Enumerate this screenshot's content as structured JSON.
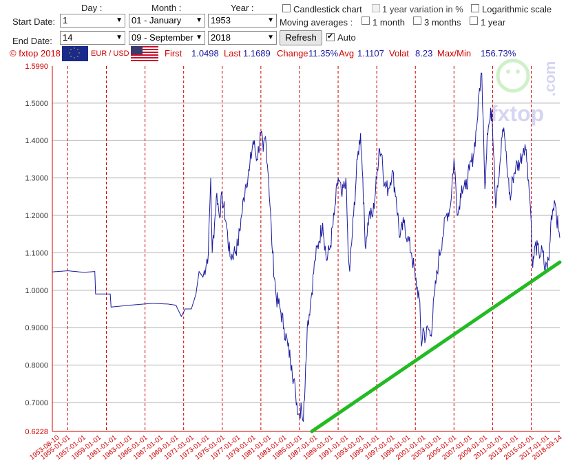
{
  "form": {
    "day_label": "Day :",
    "month_label": "Month :",
    "year_label": "Year :",
    "start_label": "Start Date:",
    "end_label": "End Date:",
    "start_day": "1",
    "start_month": "01 - January",
    "start_year": "1953",
    "end_day": "14",
    "end_month": "09 - September",
    "end_year": "2018",
    "refresh_label": "Refresh",
    "moving_label": "Moving averages :",
    "candlestick_label": "Candlestick chart",
    "variation_label": "1 year variation in %",
    "log_label": "Logarithmic scale",
    "ma_1m_label": "1 month",
    "ma_3m_label": "3 months",
    "ma_1y_label": "1 year",
    "auto_label": "Auto",
    "auto_checked": true
  },
  "info": {
    "copyright": "© fxtop 2018",
    "pair": "EUR / USD",
    "first_label": "First",
    "first_value": "1.0498",
    "last_label": "Last",
    "last_value": "1.1689",
    "change_label": "Change",
    "change_value": "11.35%",
    "avg_label": "Avg",
    "avg_value": "1.1107",
    "volat_label": "Volat",
    "volat_value": "8.23",
    "maxmin_label": "Max/Min",
    "maxmin_value": "156.73%"
  },
  "watermark": "fxtop",
  "watermark_suffix": ".com",
  "colors": {
    "price_line": "#1a1aa0",
    "trend_line": "#22bb22",
    "axis_red": "#d00000",
    "grid_h": "#b0b0b0"
  },
  "chart_data": {
    "type": "line",
    "yticks": [
      "0.6228",
      "0.7000",
      "0.8000",
      "0.9000",
      "1.0000",
      "1.1000",
      "1.2000",
      "1.3000",
      "1.4000",
      "1.5000",
      "1.5990"
    ],
    "ylim": [
      0.6228,
      1.599
    ],
    "xlim": [
      1953.0,
      2018.7
    ],
    "xticks": [
      "1953-08-10",
      "1955-01-01",
      "1957-01-01",
      "1959-01-01",
      "1961-01-01",
      "1963-01-01",
      "1965-01-01",
      "1967-01-01",
      "1969-01-01",
      "1971-01-01",
      "1973-01-01",
      "1975-01-01",
      "1977-01-01",
      "1979-01-01",
      "1981-01-01",
      "1983-01-01",
      "1985-01-01",
      "1987-01-01",
      "1989-01-01",
      "1991-01-01",
      "1993-01-01",
      "1995-01-01",
      "1997-01-01",
      "1999-01-01",
      "2001-01-01",
      "2003-01-01",
      "2005-01-01",
      "2007-01-01",
      "2009-01-01",
      "2011-01-01",
      "2013-01-01",
      "2015-01-01",
      "2017-01-01",
      "2018-09-14"
    ],
    "grid_years": [
      1955,
      1960,
      1965,
      1970,
      1975,
      1980,
      1985,
      1990,
      1995,
      2000,
      2005,
      2010,
      2015
    ],
    "series": [
      {
        "x": [
          1953.0,
          1955.0,
          1957.0,
          1957.2,
          1958.5,
          1958.6,
          1960.5,
          1960.6,
          1963.0,
          1966.0,
          1968.0,
          1969.0,
          1969.7,
          1970.2,
          1971.0,
          1971.6,
          1972.0,
          1972.5,
          1973.2,
          1973.5,
          1973.7,
          1974.0,
          1974.3,
          1974.6,
          1975.0,
          1975.5,
          1976.0,
          1976.5,
          1977.0,
          1977.5,
          1978.0,
          1978.5,
          1979.0,
          1979.5,
          1980.0,
          1980.3,
          1980.6,
          1981.0,
          1981.5,
          1982.0,
          1982.5,
          1983.0,
          1983.5,
          1984.0,
          1984.5,
          1985.0,
          1985.2,
          1985.5,
          1985.8,
          1986.0,
          1986.5,
          1987.0,
          1987.5,
          1988.0,
          1988.5,
          1989.0,
          1989.5,
          1990.0,
          1990.5,
          1991.0,
          1991.3,
          1991.5,
          1992.0,
          1992.5,
          1992.9,
          1993.2,
          1993.5,
          1994.0,
          1994.5,
          1995.0,
          1995.3,
          1995.7,
          1996.0,
          1996.5,
          1997.0,
          1997.5,
          1998.0,
          1998.5,
          1999.0,
          1999.5,
          2000.0,
          2000.5,
          2000.8,
          2001.0,
          2001.3,
          2001.6,
          2002.0,
          2002.5,
          2003.0,
          2003.5,
          2004.0,
          2004.5,
          2005.0,
          2005.5,
          2006.0,
          2006.5,
          2007.0,
          2007.5,
          2008.0,
          2008.3,
          2008.6,
          2008.8,
          2009.0,
          2009.3,
          2009.6,
          2009.9,
          2010.2,
          2010.4,
          2010.6,
          2011.0,
          2011.3,
          2011.6,
          2012.0,
          2012.3,
          2012.6,
          2013.0,
          2013.5,
          2014.0,
          2014.2,
          2014.5,
          2014.8,
          2015.0,
          2015.2,
          2015.5,
          2016.0,
          2016.5,
          2016.8,
          2017.0,
          2017.3,
          2017.6,
          2018.0,
          2018.2,
          2018.5,
          2018.7
        ],
        "y": [
          1.049,
          1.052,
          1.048,
          1.048,
          1.05,
          0.99,
          0.99,
          0.955,
          0.96,
          0.965,
          0.963,
          0.96,
          0.93,
          0.95,
          0.95,
          0.99,
          1.05,
          1.035,
          1.1,
          1.3,
          1.1,
          1.18,
          1.26,
          1.2,
          1.25,
          1.18,
          1.09,
          1.1,
          1.12,
          1.2,
          1.28,
          1.32,
          1.4,
          1.35,
          1.42,
          1.37,
          1.41,
          1.3,
          1.1,
          0.98,
          0.95,
          0.9,
          0.85,
          0.8,
          0.72,
          0.66,
          0.7,
          0.65,
          0.8,
          0.9,
          0.98,
          1.08,
          1.13,
          1.18,
          1.08,
          1.12,
          1.2,
          1.3,
          1.25,
          1.3,
          1.1,
          1.05,
          1.2,
          1.35,
          1.42,
          1.3,
          1.12,
          1.2,
          1.2,
          1.3,
          1.38,
          1.36,
          1.28,
          1.27,
          1.32,
          1.25,
          1.14,
          1.18,
          1.14,
          1.1,
          1.03,
          0.98,
          0.85,
          0.9,
          0.87,
          0.9,
          0.88,
          0.99,
          1.08,
          1.14,
          1.2,
          1.22,
          1.35,
          1.2,
          1.28,
          1.27,
          1.32,
          1.36,
          1.45,
          1.54,
          1.58,
          1.45,
          1.27,
          1.42,
          1.45,
          1.48,
          1.35,
          1.22,
          1.28,
          1.35,
          1.43,
          1.4,
          1.3,
          1.24,
          1.3,
          1.33,
          1.34,
          1.38,
          1.39,
          1.34,
          1.25,
          1.18,
          1.06,
          1.12,
          1.1,
          1.1,
          1.05,
          1.07,
          1.08,
          1.2,
          1.24,
          1.22,
          1.16,
          1.14
        ],
        "name": "EUR / USD"
      }
    ],
    "trend_line": {
      "x": [
        1986.6,
        2018.7
      ],
      "y": [
        0.6228,
        1.075
      ]
    }
  }
}
